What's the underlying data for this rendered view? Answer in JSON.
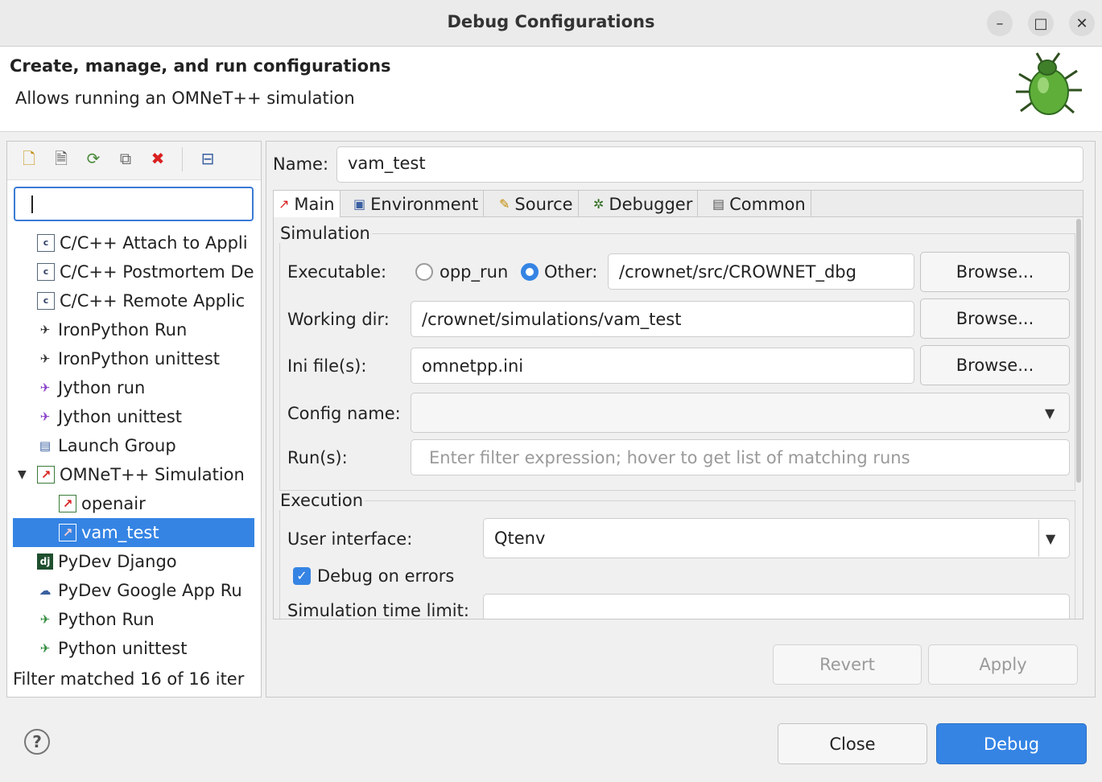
{
  "window": {
    "title": "Debug Configurations",
    "controls": {
      "minimize": "–",
      "maximize": "□",
      "close": "✕"
    }
  },
  "header": {
    "title": "Create, manage, and run configurations",
    "subtitle": "Allows running an OMNeT++ simulation",
    "icon": "bug-icon"
  },
  "left_toolbar": {
    "icons": [
      "new-configuration-icon",
      "new-prototype-icon",
      "export-icon",
      "duplicate-icon",
      "delete-icon",
      "collapse-all-icon"
    ]
  },
  "tree": {
    "filter_value": "",
    "items": [
      {
        "label": "C/C++ Attach to Appli",
        "icon": "c-app-icon"
      },
      {
        "label": "C/C++ Postmortem De",
        "icon": "c-app-icon"
      },
      {
        "label": "C/C++ Remote Applic",
        "icon": "c-app-icon"
      },
      {
        "label": "IronPython Run",
        "icon": "python-icon"
      },
      {
        "label": "IronPython unittest",
        "icon": "python-icon"
      },
      {
        "label": "Jython run",
        "icon": "python-icon"
      },
      {
        "label": "Jython unittest",
        "icon": "python-icon"
      },
      {
        "label": "Launch Group",
        "icon": "launch-group-icon"
      },
      {
        "label": "OMNeT++ Simulation",
        "icon": "omnet-icon"
      },
      {
        "label": "openair",
        "icon": "omnet-icon"
      },
      {
        "label": "vam_test",
        "icon": "omnet-icon"
      },
      {
        "label": "PyDev Django",
        "icon": "django-icon"
      },
      {
        "label": "PyDev Google App Ru",
        "icon": "pydev-icon"
      },
      {
        "label": "Python Run",
        "icon": "python-icon"
      },
      {
        "label": "Python unittest",
        "icon": "python-icon"
      }
    ],
    "status": "Filter matched 16 of 16 iter"
  },
  "config": {
    "name_label": "Name:",
    "name_value": "vam_test",
    "tabs": [
      {
        "label": "Main",
        "icon": "main-tab-icon"
      },
      {
        "label": "Environment",
        "icon": "environment-tab-icon"
      },
      {
        "label": "Source",
        "icon": "source-tab-icon"
      },
      {
        "label": "Debugger",
        "icon": "debugger-tab-icon"
      },
      {
        "label": "Common",
        "icon": "common-tab-icon"
      }
    ],
    "simulation": {
      "group_label": "Simulation",
      "executable_label": "Executable:",
      "opp_run_label": "opp_run",
      "other_label": "Other:",
      "executable_value": "/crownet/src/CROWNET_dbg",
      "workdir_label": "Working dir:",
      "workdir_value": "/crownet/simulations/vam_test",
      "ini_label": "Ini file(s):",
      "ini_value": "omnetpp.ini",
      "config_label": "Config name:",
      "config_value": "",
      "runs_label": "Run(s):",
      "runs_placeholder": "Enter filter expression; hover to get list of matching runs",
      "browse_label": "Browse..."
    },
    "execution": {
      "group_label": "Execution",
      "ui_label": "User interface:",
      "ui_value": "Qtenv",
      "debug_on_errors_label": "Debug on errors",
      "time_limit_label": "Simulation time limit:"
    },
    "revert_label": "Revert",
    "apply_label": "Apply"
  },
  "footer": {
    "help": "?",
    "close_label": "Close",
    "debug_label": "Debug"
  },
  "colors": {
    "accent": "#3584e4",
    "selection": "#3584e4"
  }
}
